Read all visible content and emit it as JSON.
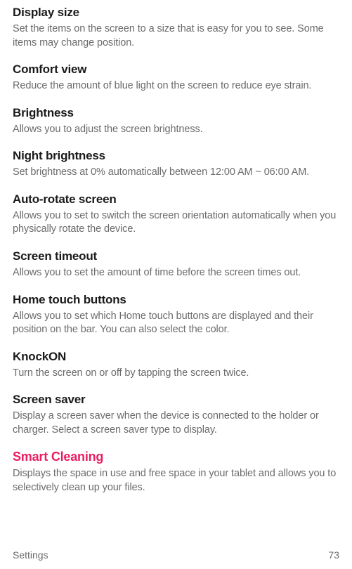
{
  "sections": [
    {
      "title": "Display size",
      "desc": "Set the items on the screen to a size that is easy for you to see. Some items may change position."
    },
    {
      "title": "Comfort view",
      "desc": "Reduce the amount of blue light on the screen to reduce eye strain."
    },
    {
      "title": "Brightness",
      "desc": "Allows you to adjust the screen brightness."
    },
    {
      "title": "Night brightness",
      "desc": "Set brightness at 0% automatically between 12:00 AM ~ 06:00 AM."
    },
    {
      "title": "Auto-rotate screen",
      "desc": "Allows you to set to switch the screen orientation automatically when you physically rotate the device."
    },
    {
      "title": "Screen timeout",
      "desc": "Allows you to set the amount of time before the screen times out."
    },
    {
      "title": "Home touch buttons",
      "desc": "Allows you to set which Home touch buttons are displayed and their position on the bar. You can also select the color."
    },
    {
      "title": "KnockON",
      "desc": "Turn the screen on or off by tapping the screen twice."
    },
    {
      "title": "Screen saver",
      "desc": "Display a screen saver when the device is connected to the holder or charger. Select a screen saver type to display."
    },
    {
      "title": "Smart Cleaning",
      "desc": "Displays the space in use and free space in your tablet and allows you to selectively clean up your files.",
      "accent": true
    }
  ],
  "footer": {
    "category": "Settings",
    "page": "73"
  }
}
